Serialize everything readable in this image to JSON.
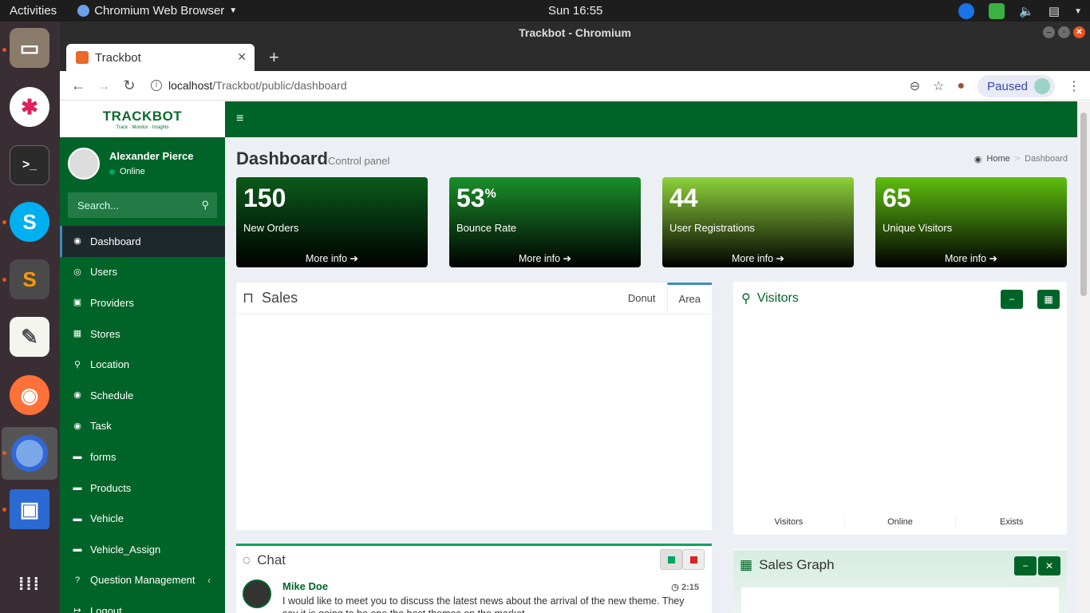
{
  "system": {
    "activities": "Activities",
    "app_menu": "Chromium Web Browser",
    "clock": "Sun 16:55"
  },
  "window": {
    "title": "Trackbot - Chromium"
  },
  "browser": {
    "tab_title": "Trackbot",
    "url_host": "localhost",
    "url_path": "/Trackbot/public/dashboard",
    "profile_label": "Paused"
  },
  "app": {
    "logo": "TRACKBOT",
    "logo_tagline": "Track · Monitor · Insights",
    "user_name": "Alexander Pierce",
    "user_status": "Online",
    "search_placeholder": "Search...",
    "menu": [
      {
        "label": "Dashboard",
        "icon": "dashboard-icon"
      },
      {
        "label": "Users",
        "icon": "user-icon"
      },
      {
        "label": "Providers",
        "icon": "lock-icon"
      },
      {
        "label": "Stores",
        "icon": "building-icon"
      },
      {
        "label": "Location",
        "icon": "map-marker-icon"
      },
      {
        "label": "Schedule",
        "icon": "dashboard-icon"
      },
      {
        "label": "Task",
        "icon": "dashboard-icon"
      },
      {
        "label": "forms",
        "icon": "car-icon"
      },
      {
        "label": "Products",
        "icon": "car-icon"
      },
      {
        "label": "Vehicle",
        "icon": "car-icon"
      },
      {
        "label": "Vehicle_Assign",
        "icon": "car-icon"
      },
      {
        "label": "Question Management",
        "icon": "question-icon"
      },
      {
        "label": "Logout",
        "icon": "logout-icon"
      }
    ]
  },
  "content_header": {
    "title": "Dashboard",
    "subtitle": "Control panel",
    "breadcrumb_home": "Home",
    "breadcrumb_current": "Dashboard"
  },
  "stat_boxes": [
    {
      "value": "150",
      "suffix": "",
      "label": "New Orders",
      "more": "More info"
    },
    {
      "value": "53",
      "suffix": "%",
      "label": "Bounce Rate",
      "more": "More info"
    },
    {
      "value": "44",
      "suffix": "",
      "label": "User Registrations",
      "more": "More info"
    },
    {
      "value": "65",
      "suffix": "",
      "label": "Unique Visitors",
      "more": "More info"
    }
  ],
  "sales": {
    "title": "Sales",
    "tabs": [
      "Donut",
      "Area"
    ],
    "active_tab": "Area"
  },
  "visitors": {
    "title": "Visitors",
    "stats": [
      "Visitors",
      "Online",
      "Exists"
    ]
  },
  "chat": {
    "title": "Chat",
    "messages": [
      {
        "name": "Mike Doe",
        "time": "2:15",
        "text": "I would like to meet you to discuss the latest news about the arrival of the new theme. They say it is going to be one the best themes on the market"
      }
    ]
  },
  "sales_graph": {
    "title": "Sales Graph"
  },
  "colors": {
    "primary": "#006428",
    "sidebar_active": "#1e282c",
    "accent_blue": "#3c8dbc",
    "success": "#00a65a"
  }
}
